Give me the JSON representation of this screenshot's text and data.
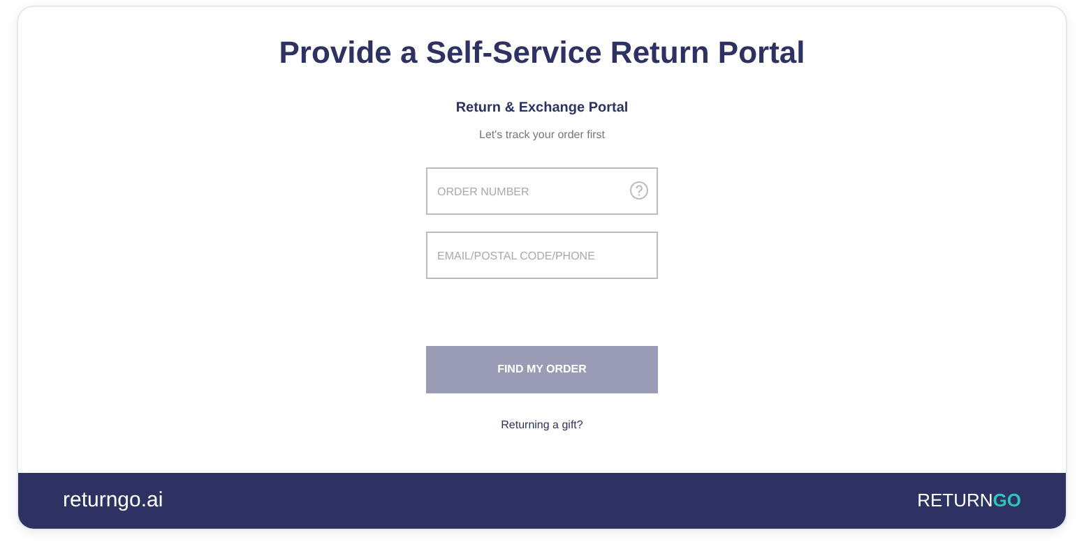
{
  "title": "Provide a Self-Service Return Portal",
  "portal": {
    "heading": "Return & Exchange Portal",
    "subheading": "Let's track your order first",
    "fields": [
      {
        "placeholder": "ORDER NUMBER",
        "help_icon": true
      },
      {
        "placeholder": "EMAIL/POSTAL CODE/PHONE",
        "help_icon": false
      }
    ],
    "button": {
      "label": "FIND MY ORDER",
      "disabled": true
    },
    "gift_link": "Returning a gift?"
  },
  "footer": {
    "site": "returngo.ai",
    "logo": [
      "RETURN",
      "GO"
    ]
  }
}
